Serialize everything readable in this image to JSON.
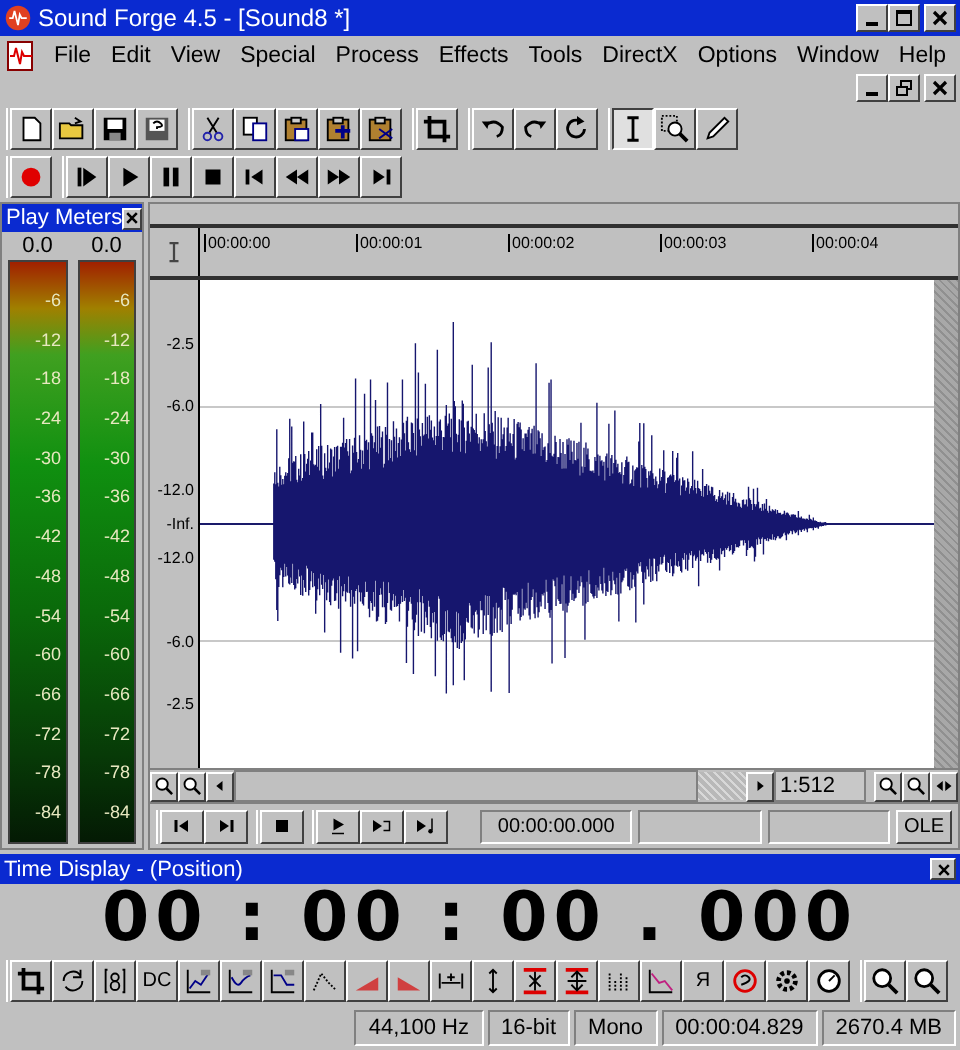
{
  "window": {
    "title": "Sound Forge 4.5 - [Sound8 *]"
  },
  "menu": [
    "File",
    "Edit",
    "View",
    "Special",
    "Process",
    "Effects",
    "Tools",
    "DirectX",
    "Options",
    "Window",
    "Help"
  ],
  "play_meters": {
    "title": "Play Meters",
    "channels": [
      {
        "peak": "0.0",
        "scale": [
          "-6",
          "-12",
          "-18",
          "-24",
          "-30",
          "-36",
          "-42",
          "-48",
          "-54",
          "-60",
          "-66",
          "-72",
          "-78",
          "-84"
        ]
      },
      {
        "peak": "0.0",
        "scale": [
          "-6",
          "-12",
          "-18",
          "-24",
          "-30",
          "-36",
          "-42",
          "-48",
          "-54",
          "-60",
          "-66",
          "-72",
          "-78",
          "-84"
        ]
      }
    ]
  },
  "sound_window": {
    "ruler": [
      "00:00:00",
      "00:00:01",
      "00:00:02",
      "00:00:03",
      "00:00:04"
    ],
    "y_axis": [
      "-2.5",
      "-6.0",
      "-12.0",
      "-Inf.",
      "-12.0",
      "-6.0",
      "-2.5"
    ],
    "zoom_ratio": "1:512",
    "position": "00:00:00.000",
    "ole_button": "OLE"
  },
  "time_display": {
    "title": "Time Display - (Position)",
    "time": "00 : 00 : 00 . 000"
  },
  "process_toolbar": {
    "text_buttons": [
      "DC",
      "Я"
    ]
  },
  "status_bar": [
    "44,100 Hz",
    "16-bit",
    "Mono",
    "00:00:04.829",
    "2670.4 MB"
  ]
}
